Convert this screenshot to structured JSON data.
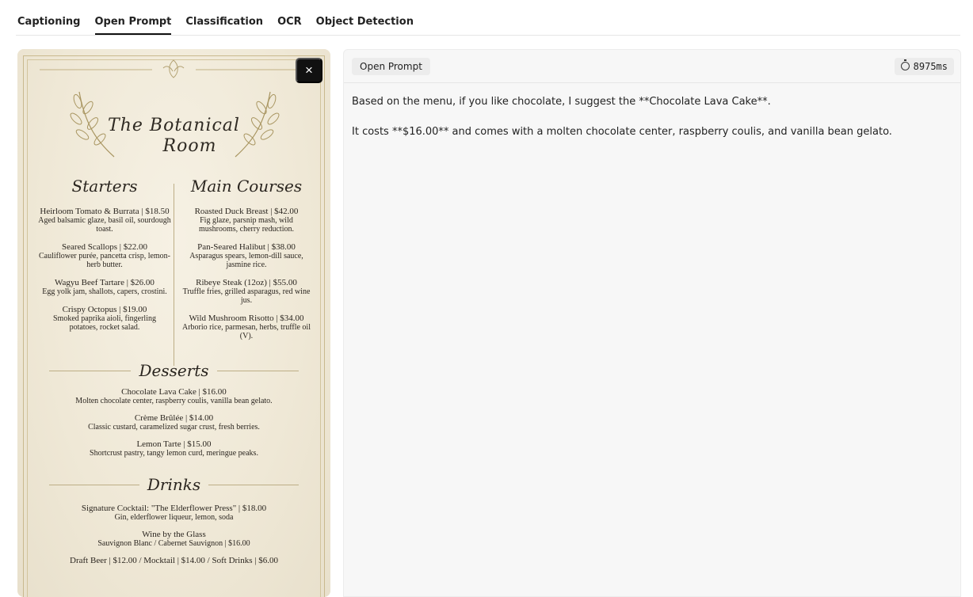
{
  "tabs": [
    {
      "label": "Captioning",
      "active": false
    },
    {
      "label": "Open Prompt",
      "active": true
    },
    {
      "label": "Classification",
      "active": false
    },
    {
      "label": "OCR",
      "active": false
    },
    {
      "label": "Object Detection",
      "active": false
    }
  ],
  "image": {
    "close_label": "×",
    "menu": {
      "title_line1": "The Botanical",
      "title_line2": "Room",
      "starters": {
        "heading": "Starters",
        "items": [
          {
            "name": "Heirloom Tomato & Burrata | $18.50",
            "desc": "Aged balsamic glaze, basil oil, sourdough toast."
          },
          {
            "name": "Seared Scallops | $22.00",
            "desc": "Cauliflower purée, pancetta crisp, lemon-herb butter."
          },
          {
            "name": "Wagyu Beef Tartare | $26.00",
            "desc": "Egg yolk jam, shallots, capers, crostini."
          },
          {
            "name": "Crispy Octopus | $19.00",
            "desc": "Smoked paprika aioli, fingerling potatoes, rocket salad."
          }
        ]
      },
      "mains": {
        "heading": "Main Courses",
        "items": [
          {
            "name": "Roasted Duck Breast | $42.00",
            "desc": "Fig glaze, parsnip mash, wild mushrooms, cherry reduction."
          },
          {
            "name": "Pan-Seared Halibut | $38.00",
            "desc": "Asparagus spears, lemon-dill sauce, jasmine rice."
          },
          {
            "name": "Ribeye Steak (12oz) | $55.00",
            "desc": "Truffle fries, grilled asparagus, red wine jus."
          },
          {
            "name": "Wild Mushroom Risotto | $34.00",
            "desc": "Arborio rice, parmesan, herbs, truffle oil (V)."
          }
        ]
      },
      "desserts": {
        "heading": "Desserts",
        "items": [
          {
            "name": "Chocolate Lava Cake | $16.00",
            "desc": "Molten chocolate center, raspberry coulis, vanilla bean gelato."
          },
          {
            "name": "Crème Brûlée | $14.00",
            "desc": "Classic custard, caramelized sugar crust, fresh berries."
          },
          {
            "name": "Lemon Tarte | $15.00",
            "desc": "Shortcrust pastry, tangy lemon curd, meringue peaks."
          }
        ]
      },
      "drinks": {
        "heading": "Drinks",
        "items": [
          {
            "name": "Signature Cocktail: \"The Elderflower Press\" | $18.00",
            "desc": "Gin, elderflower liqueur, lemon, soda"
          },
          {
            "name": "Wine by the Glass",
            "desc": "Sauvignon Blanc / Cabernet Sauvignon | $16.00"
          },
          {
            "name": "Draft Beer | $12.00 / Mocktail | $14.00 / Soft Drinks | $6.00",
            "desc": ""
          }
        ]
      }
    }
  },
  "output": {
    "mode_label": "Open Prompt",
    "timing": "8975ms",
    "paragraphs": [
      "Based on the menu, if you like chocolate, I suggest the **Chocolate Lava Cake**.",
      "It costs **$16.00** and comes with a molten chocolate center, raspberry coulis, and vanilla bean gelato."
    ]
  }
}
